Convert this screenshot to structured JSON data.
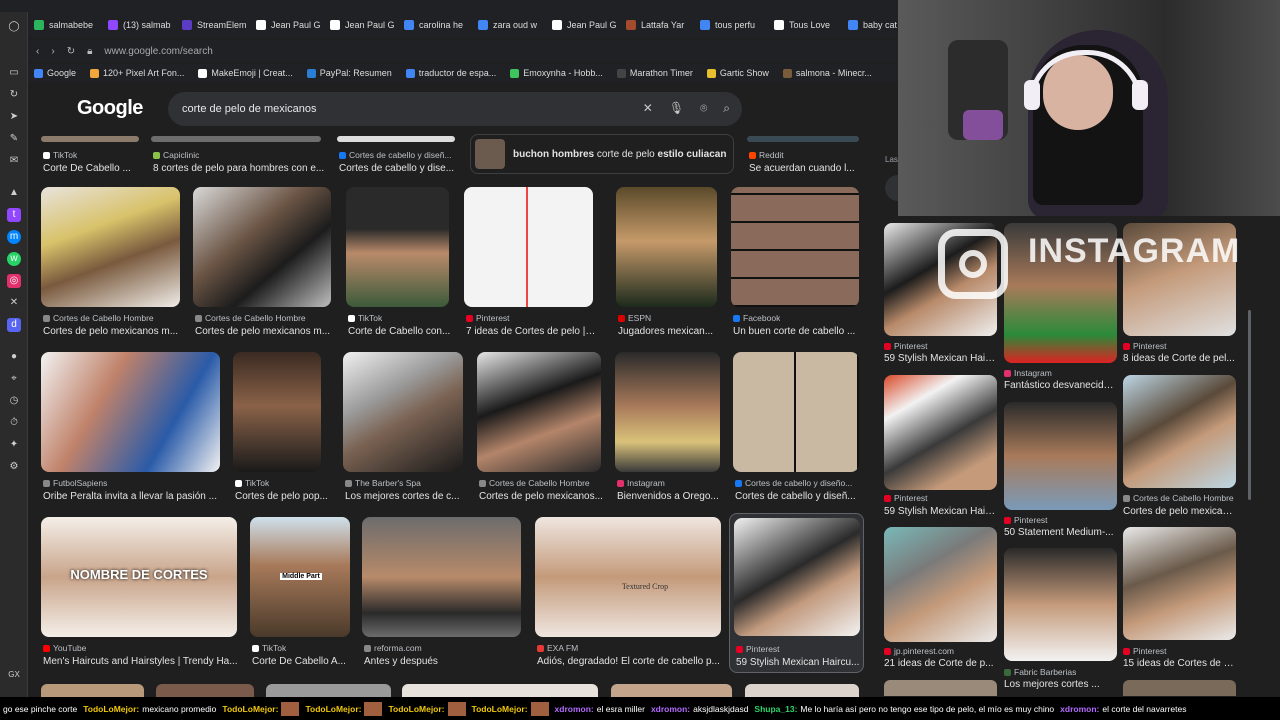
{
  "tabs": [
    {
      "label": "salmabebe",
      "color": "#2db55d"
    },
    {
      "label": "(13) salmab",
      "color": "#9146ff"
    },
    {
      "label": "StreamEleme",
      "color": "#5b3cc4"
    },
    {
      "label": "Jean Paul G",
      "color": "#ffffff"
    },
    {
      "label": "Jean Paul G",
      "color": "#ffffff"
    },
    {
      "label": "carolina he",
      "color": "#4285f4"
    },
    {
      "label": "zara oud w",
      "color": "#4285f4"
    },
    {
      "label": "Jean Paul G",
      "color": "#ffffff"
    },
    {
      "label": "Lattafa Yar",
      "color": "#a34b2c"
    },
    {
      "label": "tous perfu",
      "color": "#4285f4"
    },
    {
      "label": "Tous Love",
      "color": "#ffffff"
    },
    {
      "label": "baby cat -",
      "color": "#4285f4"
    }
  ],
  "address_bar": {
    "url": "www.google.com/search"
  },
  "bookmarks": [
    {
      "label": "Google",
      "color": "#4285f4"
    },
    {
      "label": "120+ Pixel Art Fon...",
      "color": "#f2a73b"
    },
    {
      "label": "MakeEmoji | Creat...",
      "color": "#ffffff"
    },
    {
      "label": "PayPal: Resumen",
      "color": "#2a7fd4"
    },
    {
      "label": "traductor de espa...",
      "color": "#4285f4"
    },
    {
      "label": "Emoxynha - Hobb...",
      "color": "#3ec45c"
    },
    {
      "label": "Marathon Timer",
      "color": "#444"
    },
    {
      "label": "Gartic Show",
      "color": "#e8c02e"
    },
    {
      "label": "salmona - Minecr...",
      "color": "#7a5c3a"
    }
  ],
  "google": {
    "logo": "Google",
    "query": "corte de pelo de mexicanos",
    "related_label_bold": "buchon hombres",
    "related_label_mid": "corte de pelo",
    "related_label_end": "estilo culiacan"
  },
  "row0": [
    {
      "source": "TikTok",
      "caption": "Corte De Cabello ..."
    },
    {
      "source": "Capiclinic",
      "caption": "8 cortes de pelo para hombres con e..."
    },
    {
      "source": "Cortes de cabello y diseñ...",
      "caption": "Cortes de cabello y dise..."
    },
    {
      "source": "Reddit",
      "caption": "Se acuerdan cuando l..."
    }
  ],
  "row1": [
    {
      "source": "Cortes de Cabello Hombre",
      "caption": "Cortes de pelo mexicanos m..."
    },
    {
      "source": "Cortes de Cabello Hombre",
      "caption": "Cortes de pelo mexicanos m..."
    },
    {
      "source": "TikTok",
      "caption": "Corte de Cabello con..."
    },
    {
      "source": "Pinterest",
      "caption": "7 ideas de Cortes de pelo | c..."
    },
    {
      "source": "ESPN",
      "caption": "Jugadores mexican..."
    },
    {
      "source": "Facebook",
      "caption": "Un buen corte de cabello ..."
    }
  ],
  "row2": [
    {
      "source": "FutbolSapiens",
      "caption": "Oribe Peralta invita a llevar la pasión ..."
    },
    {
      "source": "TikTok",
      "caption": "Cortes de pelo pop..."
    },
    {
      "source": "The Barber's Spa",
      "caption": "Los mejores cortes de c..."
    },
    {
      "source": "Cortes de Cabello Hombre",
      "caption": "Cortes de pelo mexicanos..."
    },
    {
      "source": "Instagram",
      "caption": "Bienvenidos a Orego..."
    },
    {
      "source": "Cortes de cabello y diseño...",
      "caption": "Cortes de cabello y diseñ..."
    }
  ],
  "row3": [
    {
      "source": "YouTube",
      "caption": "Men's Haircuts and Hairstyles | Trendy Ha...",
      "overlay": "NOMBRE DE CORTES"
    },
    {
      "source": "TikTok",
      "caption": "Corte De Cabello A...",
      "overlay": "Middle Part"
    },
    {
      "source": "reforma.com",
      "caption": "Antes y después"
    },
    {
      "source": "EXA FM",
      "caption": "Adiós, degradado! El corte de cabello p...",
      "overlay": "Textured Crop"
    },
    {
      "source": "Pinterest",
      "caption": "59 Stylish Mexican Haircu..."
    }
  ],
  "side": [
    {
      "source": "Pinterest",
      "caption": "59 Stylish Mexican Hair..."
    },
    {
      "source": "Instagram",
      "caption": "Fantástico desvanecido..."
    },
    {
      "source": "Pinterest",
      "caption": "8 ideas de Corte de pel..."
    },
    {
      "source": "Pinterest",
      "caption": "59 Stylish Mexican Hair..."
    },
    {
      "source": "Pinterest",
      "caption": "50 Statement Medium-..."
    },
    {
      "source": "Cortes de Cabello Hombre",
      "caption": "Cortes de pelo mexican..."
    },
    {
      "source": "jp.pinterest.com",
      "caption": "21 ideas de Corte de p..."
    },
    {
      "source": "Fabric Barberias",
      "caption": "Los mejores cortes ..."
    },
    {
      "source": "Pinterest",
      "caption": "15 ideas de Cortes de c..."
    }
  ],
  "side_header": "Las",
  "webcam_overlay": "INSTAGRAM",
  "chat": [
    {
      "user": "",
      "text": "go ese pinche corte",
      "color": "#fff"
    },
    {
      "user": "TodoLoMejor:",
      "text": "mexicano promedio",
      "color": "#f0c808"
    },
    {
      "user": "TodoLoMejor:",
      "text": "",
      "color": "#f0c808"
    },
    {
      "user": "TodoLoMejor:",
      "text": "",
      "color": "#f0c808"
    },
    {
      "user": "TodoLoMejor:",
      "text": "",
      "color": "#f0c808"
    },
    {
      "user": "TodoLoMejor:",
      "text": "",
      "color": "#f0c808"
    },
    {
      "user": "xdromon:",
      "text": "el esra miller",
      "color": "#b36bff"
    },
    {
      "user": "xdromon:",
      "text": "aksjdlaskjdasd",
      "color": "#b36bff"
    },
    {
      "user": "Shupa_13:",
      "text": "Me lo haría así pero no tengo ese tipo de pelo, el mío es muy chino",
      "color": "#2fd36a"
    },
    {
      "user": "xdromon:",
      "text": "el corte del navarretes",
      "color": "#b36bff"
    }
  ]
}
